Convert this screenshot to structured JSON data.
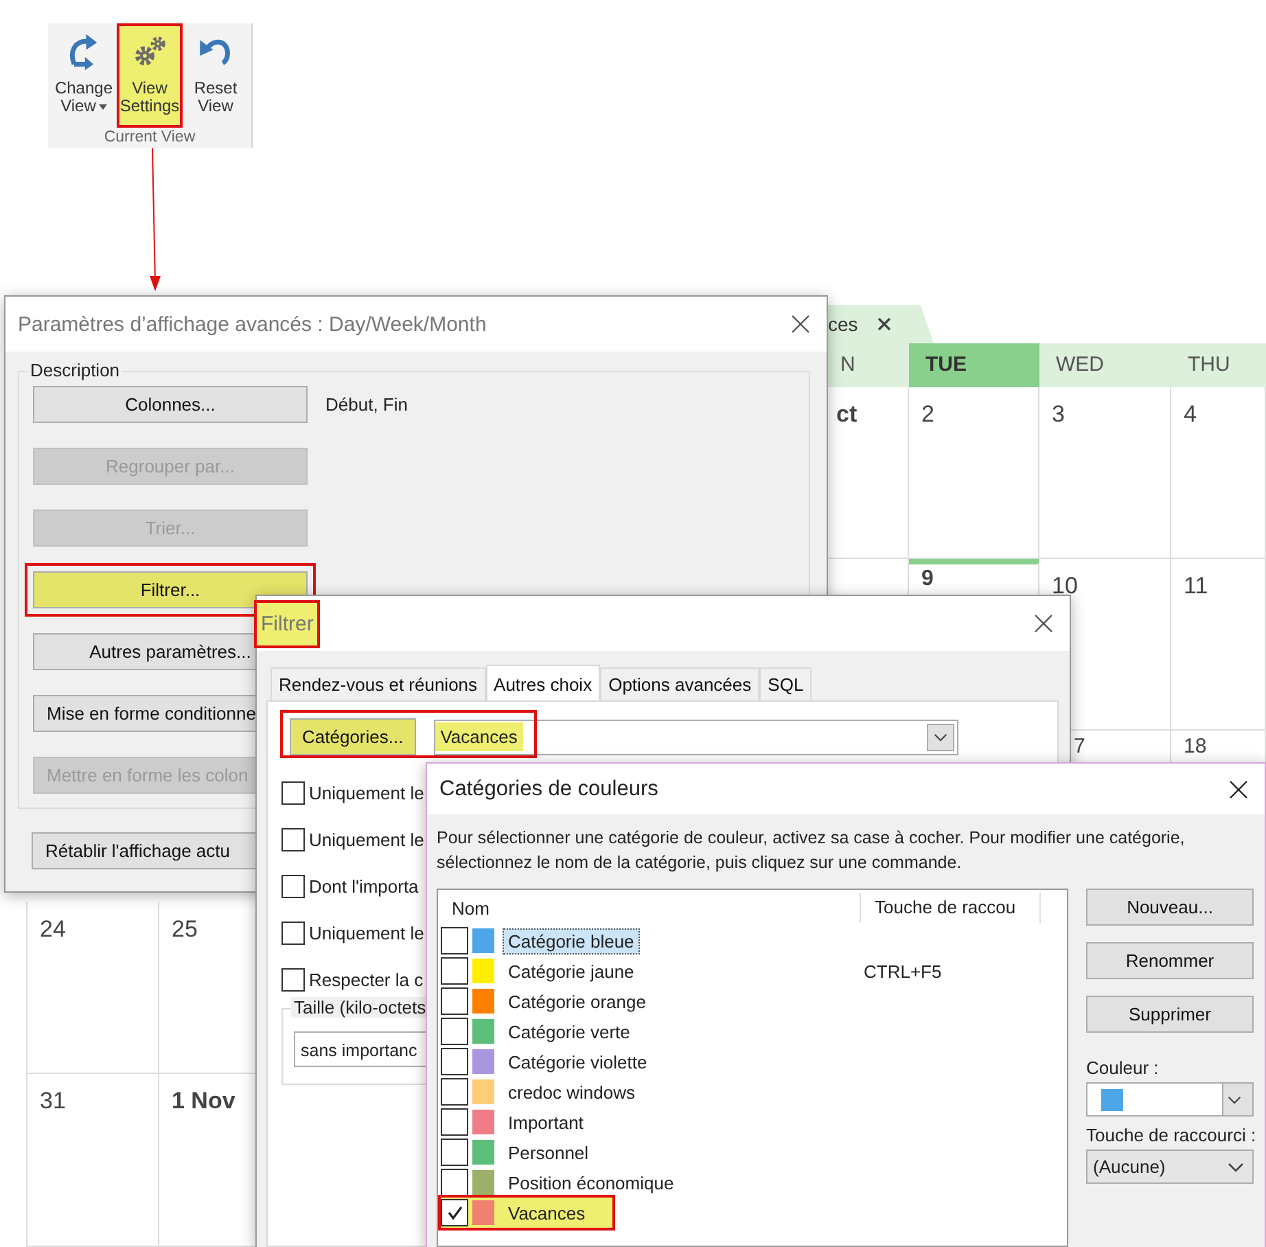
{
  "ribbon": {
    "group_label": "Current View",
    "buttons": [
      {
        "kind": "change",
        "lines": [
          "Change",
          "View"
        ],
        "dropdown": true,
        "highlighted": false
      },
      {
        "kind": "settings",
        "lines": [
          "View",
          "Settings"
        ],
        "dropdown": false,
        "highlighted": true
      },
      {
        "kind": "reset",
        "lines": [
          "Reset",
          "View"
        ],
        "dropdown": false,
        "highlighted": false
      }
    ]
  },
  "pointer_arrow": true,
  "calendar": {
    "tab": {
      "label": "ces"
    },
    "headers": [
      {
        "label": "N",
        "selected": false
      },
      {
        "label": "TUE",
        "selected": true
      },
      {
        "label": "WED",
        "selected": false
      },
      {
        "label": "THU",
        "selected": false
      }
    ],
    "upper_weeks": [
      {
        "kind": "full",
        "days": [
          {
            "label": "ct",
            "bold": true,
            "today": false
          },
          {
            "label": "2",
            "bold": false,
            "today": false
          },
          {
            "label": "3",
            "bold": false,
            "today": false
          },
          {
            "label": "4",
            "bold": false,
            "today": false
          }
        ]
      },
      {
        "kind": "full",
        "days": [
          {
            "label": "9",
            "bold": true,
            "today": true
          },
          {
            "label": "10",
            "bold": false,
            "today": false
          },
          {
            "label": "11",
            "bold": false,
            "today": false
          }
        ]
      },
      {
        "kind": "partial",
        "days": [
          {
            "label": "7",
            "bold": false,
            "today": false,
            "kind": "cut"
          },
          {
            "label": "18",
            "bold": false,
            "today": false
          }
        ]
      }
    ],
    "lower_weeks": [
      {
        "days": [
          {
            "label": "24",
            "bold": false,
            "today": false
          },
          {
            "label": "25",
            "bold": false,
            "today": false
          }
        ]
      },
      {
        "days": [
          {
            "label": "31",
            "bold": false,
            "today": false
          },
          {
            "label": "1 Nov",
            "bold": true,
            "today": false
          }
        ]
      }
    ]
  },
  "view_settings_dialog": {
    "title": "Paramètres d’affichage avancés : Day/Week/Month",
    "group_label": "Description",
    "buttons": [
      {
        "label": "Colonnes...",
        "kind": "full",
        "disabled": false,
        "highlighted": false,
        "note": "Début, Fin"
      },
      {
        "label": "Regrouper par...",
        "kind": "full",
        "disabled": true,
        "highlighted": false
      },
      {
        "label": "Trier...",
        "kind": "full",
        "disabled": true,
        "highlighted": false
      },
      {
        "label": "Filtrer...",
        "kind": "full",
        "disabled": false,
        "highlighted": true
      },
      {
        "label": "Autres paramètres...",
        "kind": "full",
        "disabled": false,
        "highlighted": false
      },
      {
        "label": "Mise en forme conditionne",
        "kind": "cut",
        "disabled": false,
        "highlighted": false
      },
      {
        "label": "Mettre en forme les colon",
        "kind": "cut",
        "disabled": true,
        "highlighted": false
      }
    ],
    "reset_button": {
      "label": "Rétablir l'affichage actu",
      "kind": "cut"
    }
  },
  "filter_dialog": {
    "title": "Filtrer",
    "title_highlighted": true,
    "tabs": [
      {
        "label": "Rendez-vous et réunions",
        "selected": false
      },
      {
        "label": "Autres choix",
        "selected": true
      },
      {
        "label": "Options avancées",
        "selected": false
      },
      {
        "label": "SQL",
        "selected": false
      }
    ],
    "categories_button": {
      "label": "Catégories...",
      "highlighted": true
    },
    "categories_field": {
      "value": "Vacances",
      "highlighted": true
    },
    "checkboxes": [
      {
        "label": "Uniquement le",
        "checked": false
      },
      {
        "label": "Uniquement le",
        "checked": false
      },
      {
        "label": "Dont l'importa",
        "checked": false
      },
      {
        "label": "Uniquement le",
        "checked": false
      },
      {
        "label": "Respecter la c",
        "checked": false
      }
    ],
    "size_group": {
      "label": "Taille (kilo-octets",
      "value": "sans importanc"
    }
  },
  "color_categories_dialog": {
    "title": "Catégories de couleurs",
    "instructions": "Pour sélectionner une catégorie de couleur, activez sa case à cocher. Pour modifier une catégorie, sélectionnez le nom de la catégorie, puis cliquez sur une commande.",
    "columns": [
      "Nom",
      "Touche de raccou"
    ],
    "categories": [
      {
        "name": "Catégorie bleue",
        "color": "#4da6e8",
        "checked": false,
        "selected": true,
        "highlighted": false
      },
      {
        "name": "Catégorie jaune",
        "color": "#ffee00",
        "checked": false,
        "selected": false,
        "highlighted": false,
        "shortcut": "CTRL+F5"
      },
      {
        "name": "Catégorie orange",
        "color": "#ff8000",
        "checked": false,
        "selected": false,
        "highlighted": false
      },
      {
        "name": "Catégorie verte",
        "color": "#5cbf7a",
        "checked": false,
        "selected": false,
        "highlighted": false
      },
      {
        "name": "Catégorie violette",
        "color": "#a896e0",
        "checked": false,
        "selected": false,
        "highlighted": false
      },
      {
        "name": "credoc windows",
        "color": "#ffcc77",
        "checked": false,
        "selected": false,
        "highlighted": false
      },
      {
        "name": "Important",
        "color": "#f07c88",
        "checked": false,
        "selected": false,
        "highlighted": false
      },
      {
        "name": "Personnel",
        "color": "#5cbf7a",
        "checked": false,
        "selected": false,
        "highlighted": false
      },
      {
        "name": "Position économique",
        "color": "#9cb06a",
        "checked": false,
        "selected": false,
        "highlighted": false
      },
      {
        "name": "Vacances",
        "color": "#f08070",
        "checked": true,
        "selected": false,
        "highlighted": true
      }
    ],
    "buttons": [
      "Nouveau...",
      "Renommer",
      "Supprimer"
    ],
    "color_label": "Couleur :",
    "color_value": {
      "color": "#4da6e8"
    },
    "shortcut_label": "Touche de raccourci :",
    "shortcut_value": "(Aucune)"
  }
}
